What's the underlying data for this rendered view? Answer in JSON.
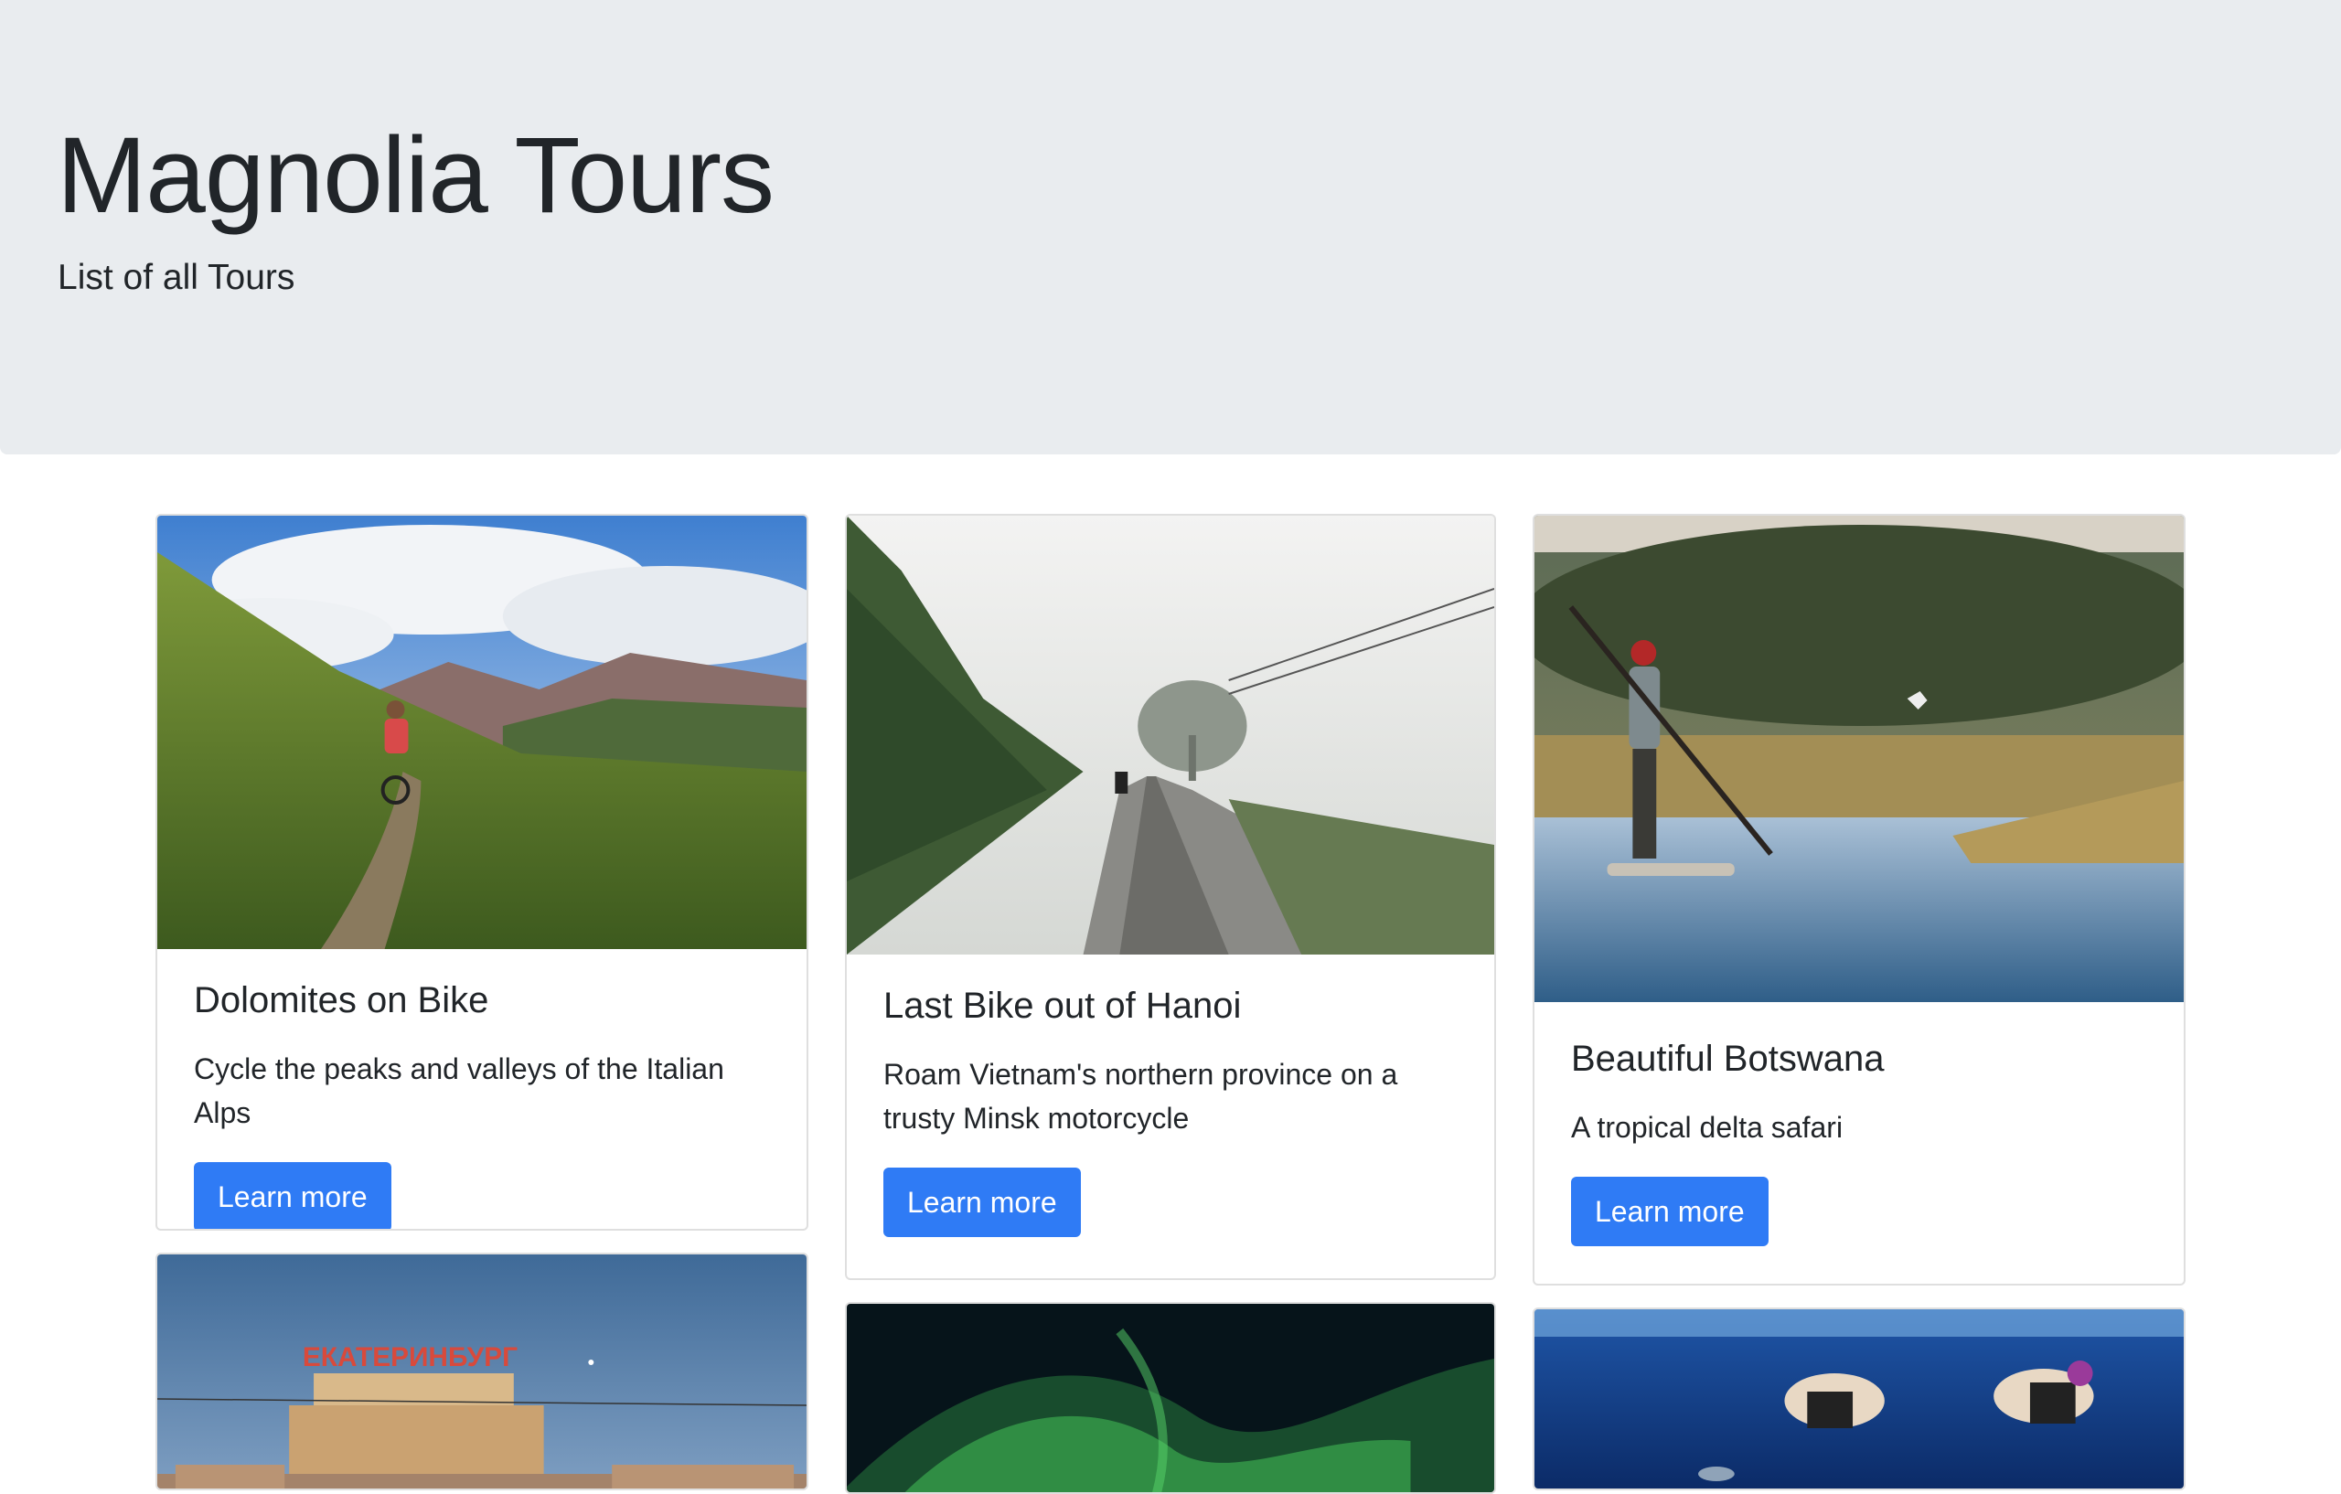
{
  "header": {
    "title": "Magnolia Tours",
    "subtitle": "List of all Tours"
  },
  "tours": [
    {
      "title": "Dolomites on Bike",
      "description": "Cycle the peaks and valleys of the Italian Alps",
      "button_label": "Learn more",
      "image": "mountain-biker-valley-photo"
    },
    {
      "title": "Last Bike out of Hanoi",
      "description": "Roam Vietnam's northern province on a trusty Minsk motorcycle",
      "button_label": "Learn more",
      "image": "foggy-road-motorcycle-photo"
    },
    {
      "title": "Beautiful Botswana",
      "description": "A tropical delta safari",
      "button_label": "Learn more",
      "image": "delta-boatman-photo"
    },
    {
      "image": "yekaterinburg-station-photo",
      "image_sign": "ЕКАТЕРИНБУРГ"
    },
    {
      "image": "northern-lights-photo"
    },
    {
      "image": "snorkelers-underwater-photo"
    }
  ],
  "colors": {
    "jumbotron_bg": "#e9ecef",
    "button_bg": "#2f7bf5",
    "text": "#212529"
  }
}
